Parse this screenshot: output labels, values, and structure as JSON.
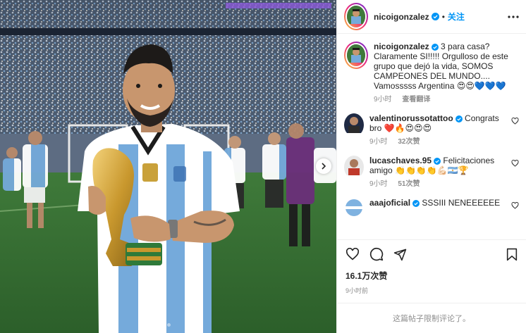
{
  "post": {
    "author": "nicoigonzalez",
    "follow_label": "关注",
    "separator": "•",
    "caption": "3 para casa? Claramente SI!!!!! Orgulloso de este grupo que dejó la vida, SOMOS CAMPEONES DEL MUNDO.... Vamosssss Argentina 😍😍💙💙💙",
    "caption_time": "9小时",
    "translate_label": "查看翻译",
    "likes": "16.1万次赞",
    "time": "9小时前",
    "comments_limited": "这篇帖子限制评论了。"
  },
  "comments": [
    {
      "user": "valentinorussotattoo",
      "text": "Congrats bro ❤️🔥😍😍😍",
      "time": "9小时",
      "likes": "32次赞"
    },
    {
      "user": "lucaschaves.95",
      "text": "Felicitaciones amigo 👏👏👏👏💪🏻🇦🇷🏆",
      "time": "9小时",
      "likes": "51次赞"
    },
    {
      "user": "aaajoficial",
      "text": "SSSIII NENEEEEEE",
      "time": "",
      "likes": ""
    }
  ],
  "icons": {
    "verified": "verified-badge-icon",
    "more": "more-options-icon",
    "like": "heart-icon",
    "comment": "comment-icon",
    "share": "share-icon",
    "save": "bookmark-icon",
    "next": "chevron-right-icon"
  },
  "colors": {
    "accent": "#0095f6",
    "muted": "#8e8e8e",
    "jersey_blue": "#75aadb"
  }
}
